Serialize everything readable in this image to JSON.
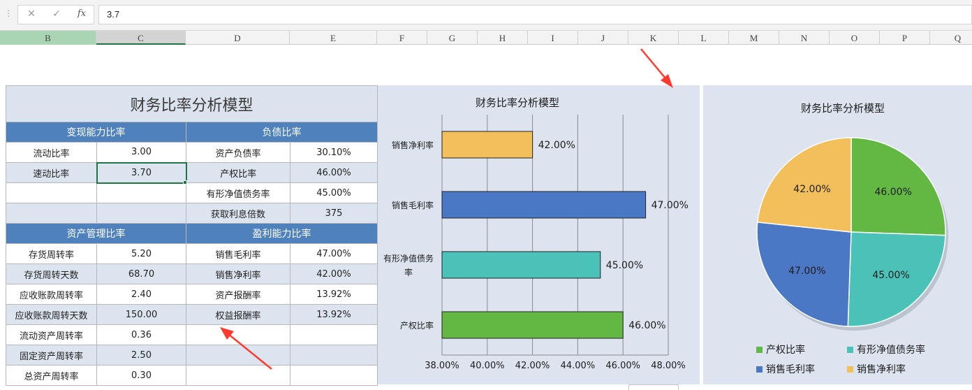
{
  "formula_bar": {
    "cancel_icon": "close-icon",
    "confirm_icon": "check-icon",
    "function_label": "fx",
    "value": "3.7"
  },
  "columns": [
    "B",
    "C",
    "D",
    "E",
    "F",
    "G",
    "H",
    "I",
    "J",
    "K",
    "L",
    "M",
    "N",
    "O",
    "P",
    "Q"
  ],
  "table": {
    "title": "财务比率分析模型",
    "section1": {
      "left_header": "变现能力比率",
      "right_header": "负债比率",
      "rows": [
        {
          "left_label": "流动比率",
          "left_value": "3.00",
          "right_label": "资产负债率",
          "right_value": "30.10%"
        },
        {
          "left_label": "速动比率",
          "left_value": "3.70",
          "right_label": "产权比率",
          "right_value": "46.00%"
        },
        {
          "left_label": "",
          "left_value": "",
          "right_label": "有形净值债务率",
          "right_value": "45.00%"
        },
        {
          "left_label": "",
          "left_value": "",
          "right_label": "获取利息倍数",
          "right_value": "375"
        }
      ]
    },
    "section2": {
      "left_header": "资产管理比率",
      "right_header": "盈利能力比率",
      "rows": [
        {
          "left_label": "存货周转率",
          "left_value": "5.20",
          "right_label": "销售毛利率",
          "right_value": "47.00%"
        },
        {
          "left_label": "存货周转天数",
          "left_value": "68.70",
          "right_label": "销售净利率",
          "right_value": "42.00%"
        },
        {
          "left_label": "应收账款周转率",
          "left_value": "2.40",
          "right_label": "资产报酬率",
          "right_value": "13.92%"
        },
        {
          "left_label": "应收账款周转天数",
          "left_value": "150.00",
          "right_label": "权益报酬率",
          "right_value": "13.92%"
        },
        {
          "left_label": "流动资产周转率",
          "left_value": "0.36",
          "right_label": "",
          "right_value": ""
        },
        {
          "left_label": "固定资产周转率",
          "left_value": "2.50",
          "right_label": "",
          "right_value": ""
        },
        {
          "left_label": "总资产周转率",
          "left_value": "0.30",
          "right_label": "",
          "right_value": ""
        }
      ]
    }
  },
  "chart_data": [
    {
      "type": "bar",
      "orientation": "horizontal",
      "title": "财务比率分析模型",
      "categories": [
        "销售净利率",
        "销售毛利率",
        "有形净值债务率",
        "产权比率"
      ],
      "values": [
        42.0,
        47.0,
        45.0,
        46.0
      ],
      "data_labels": [
        "42.00%",
        "47.00%",
        "45.00%",
        "46.00%"
      ],
      "colors": [
        "#f2bf5a",
        "#4a78c4",
        "#4bc2b8",
        "#62b843"
      ],
      "x_ticks": [
        "38.00%",
        "40.00%",
        "42.00%",
        "44.00%",
        "46.00%",
        "48.00%"
      ],
      "xlim": [
        38,
        48
      ],
      "grid": "vertical"
    },
    {
      "type": "pie",
      "title": "财务比率分析模型",
      "slices": [
        {
          "label": "产权比率",
          "value": 46.0,
          "display": "46.00%",
          "color": "#62b843"
        },
        {
          "label": "有形净值债务率",
          "value": 45.0,
          "display": "45.00%",
          "color": "#4bc2b8"
        },
        {
          "label": "销售毛利率",
          "value": 47.0,
          "display": "47.00%",
          "color": "#4a78c4"
        },
        {
          "label": "销售净利率",
          "value": 42.0,
          "display": "42.00%",
          "color": "#f2bf5a"
        }
      ],
      "legend_position": "bottom"
    }
  ]
}
